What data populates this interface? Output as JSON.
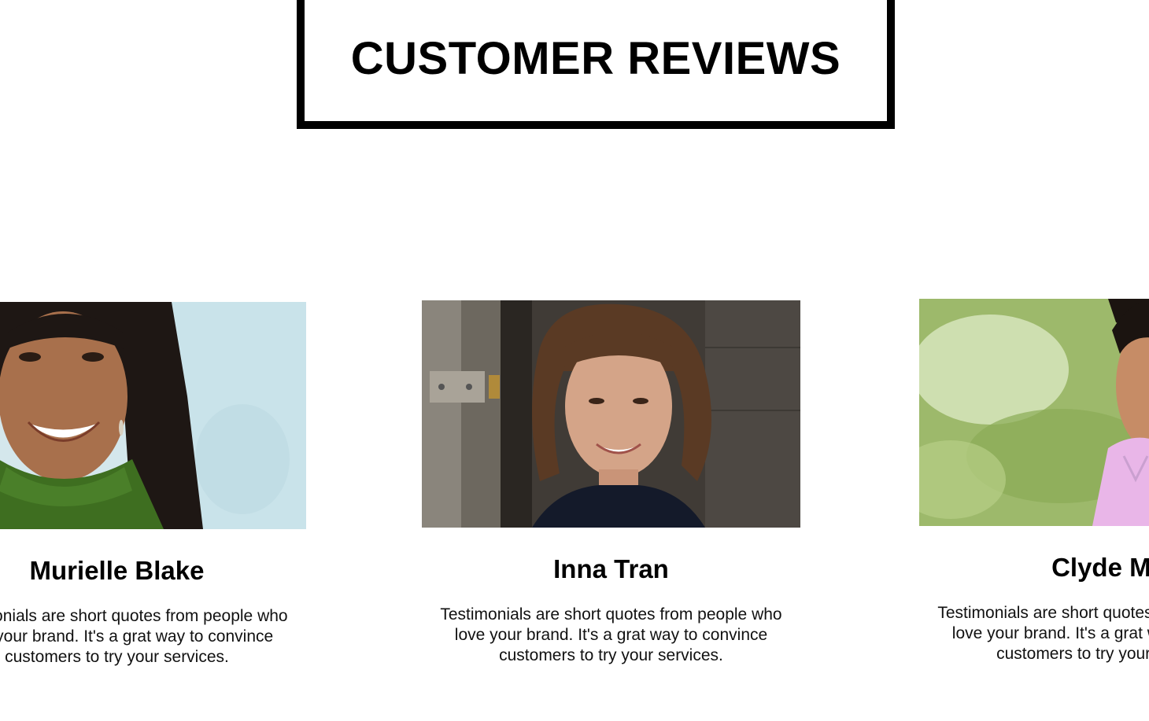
{
  "header": {
    "title": "CUSTOMER REVIEWS"
  },
  "reviews": [
    {
      "name": "Murielle Blake",
      "text": "Testimonials are short quotes from people who love your brand. It's a grat way to convince customers to try your services.",
      "photo_alt": "woman-green-sweater-photo"
    },
    {
      "name": "Inna Tran",
      "text": "Testimonials are short quotes from people who love your brand. It's a grat way to convince customers to try your services.",
      "photo_alt": "woman-curly-hair-photo"
    },
    {
      "name": "Clyde Me",
      "text": "Testimonials are short quotes from people who love your brand. It's a grat way to convince customers to try your services.",
      "photo_alt": "man-pink-shirt-photo"
    }
  ],
  "colors": {
    "background": "#ffffff",
    "text": "#000000",
    "border": "#000000"
  }
}
